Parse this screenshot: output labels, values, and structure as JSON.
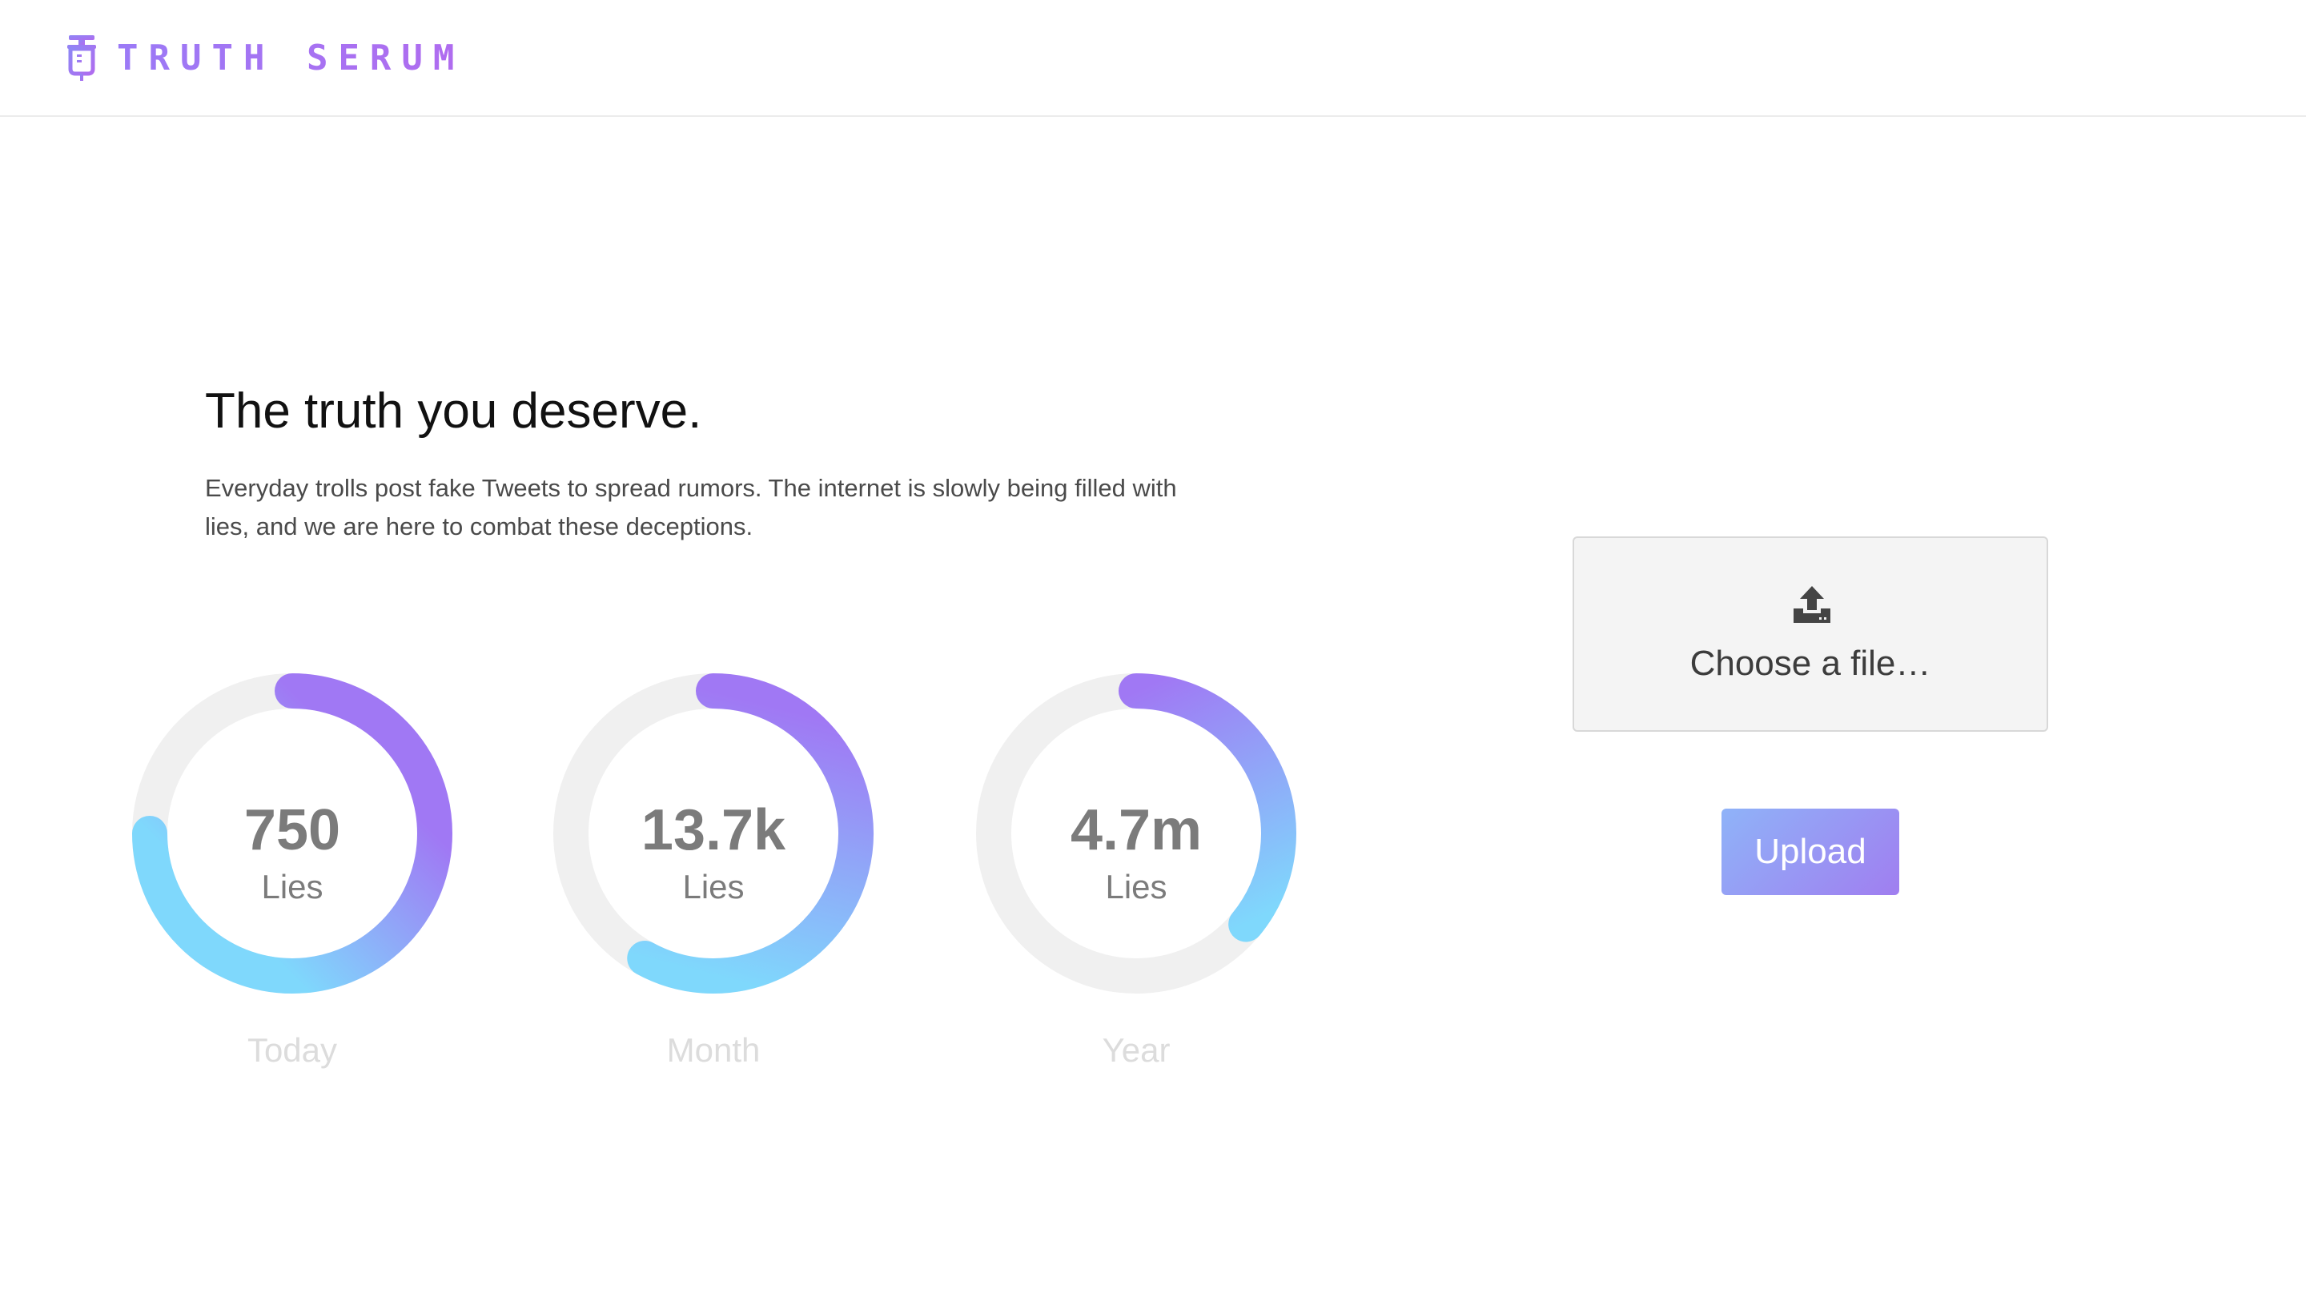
{
  "brand": {
    "name": "TRUTH SERUM",
    "icon": "syringe-icon",
    "color": "#a775f0"
  },
  "hero": {
    "title": "The truth you deserve.",
    "description": "Everyday trolls post fake Tweets to spread rumors. The internet is slowly being filled with lies, and we are here to combat these deceptions."
  },
  "stats": [
    {
      "value": "750",
      "unit": "Lies",
      "label": "Today",
      "fill": 0.75
    },
    {
      "value": "13.7k",
      "unit": "Lies",
      "label": "Month",
      "fill": 0.58
    },
    {
      "value": "4.7m",
      "unit": "Lies",
      "label": "Year",
      "fill": 0.36
    }
  ],
  "ring_colors": {
    "track": "#f0f0f0",
    "gradient_start": "#a078f4",
    "gradient_end": "#7fd8fc"
  },
  "upload": {
    "icon": "upload-icon",
    "choose_label": "Choose a file…",
    "button_label": "Upload"
  }
}
